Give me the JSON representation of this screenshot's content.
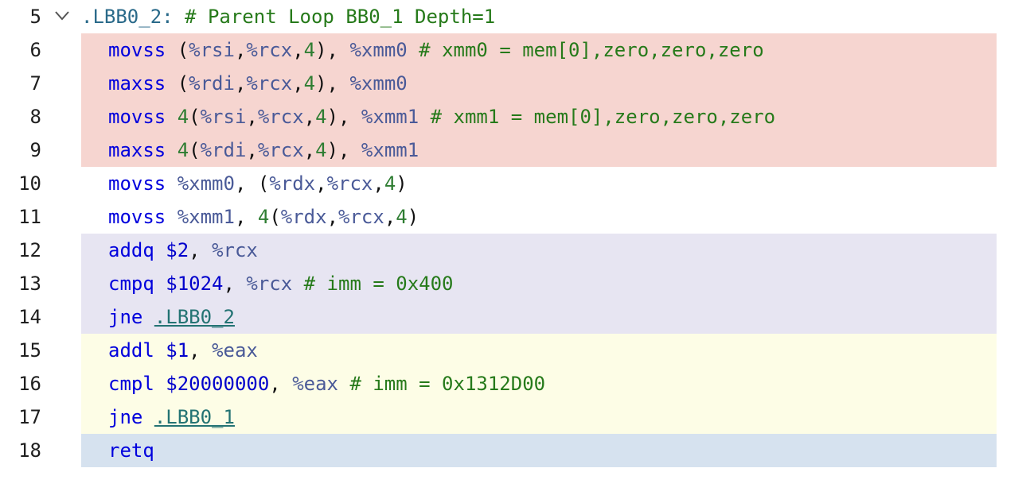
{
  "colors": {
    "block_red": "#f6d5d0",
    "block_purple": "#e7e5f2",
    "block_yellow": "#fdfde6",
    "block_blue": "#d6e2ef"
  },
  "fold_icon": "chevron-down-icon",
  "lines": [
    {
      "num": "5",
      "label": ".LBB0_2:",
      "comment": " # Parent Loop BB0_1 Depth=1"
    },
    {
      "num": "6",
      "opcode": "movss",
      "t1": " (",
      "r1": "%rsi",
      "t2": ",",
      "r2": "%rcx",
      "t3": ",",
      "n1": "4",
      "t4": "), ",
      "r3": "%xmm0",
      "comment": " # xmm0 = mem[0],zero,zero,zero"
    },
    {
      "num": "7",
      "opcode": "maxss",
      "t1": " (",
      "r1": "%rdi",
      "t2": ",",
      "r2": "%rcx",
      "t3": ",",
      "n1": "4",
      "t4": "), ",
      "r3": "%xmm0"
    },
    {
      "num": "8",
      "opcode": "movss",
      "n0": " 4",
      "t1": "(",
      "r1": "%rsi",
      "t2": ",",
      "r2": "%rcx",
      "t3": ",",
      "n1": "4",
      "t4": "), ",
      "r3": "%xmm1",
      "comment": " # xmm1 = mem[0],zero,zero,zero"
    },
    {
      "num": "9",
      "opcode": "maxss",
      "n0": " 4",
      "t1": "(",
      "r1": "%rdi",
      "t2": ",",
      "r2": "%rcx",
      "t3": ",",
      "n1": "4",
      "t4": "), ",
      "r3": "%xmm1"
    },
    {
      "num": "10",
      "opcode": "movss",
      "r0": " %xmm0",
      "t1": ", (",
      "r1": "%rdx",
      "t2": ",",
      "r2": "%rcx",
      "t3": ",",
      "n1": "4",
      "t4": ")"
    },
    {
      "num": "11",
      "opcode": "movss",
      "r0": " %xmm1",
      "t1": ", ",
      "n0": "4",
      "t2": "(",
      "r1": "%rdx",
      "t3": ",",
      "r2": "%rcx",
      "t4": ",",
      "n1": "4",
      "t5": ")"
    },
    {
      "num": "12",
      "opcode": "addq",
      "imm": " $2",
      "t1": ", ",
      "r1": "%rcx"
    },
    {
      "num": "13",
      "opcode": "cmpq",
      "imm": " $1024",
      "t1": ", ",
      "r1": "%rcx",
      "comment": " # imm = 0x400"
    },
    {
      "num": "14",
      "opcode": "jne",
      "sp": " ",
      "link": ".LBB0_2"
    },
    {
      "num": "15",
      "opcode": "addl",
      "imm": " $1",
      "t1": ", ",
      "r1": "%eax"
    },
    {
      "num": "16",
      "opcode": "cmpl",
      "imm": " $20000000",
      "t1": ", ",
      "r1": "%eax",
      "comment": " # imm = 0x1312D00"
    },
    {
      "num": "17",
      "opcode": "jne",
      "sp": " ",
      "link": ".LBB0_1"
    },
    {
      "num": "18",
      "opcode": "retq"
    }
  ]
}
